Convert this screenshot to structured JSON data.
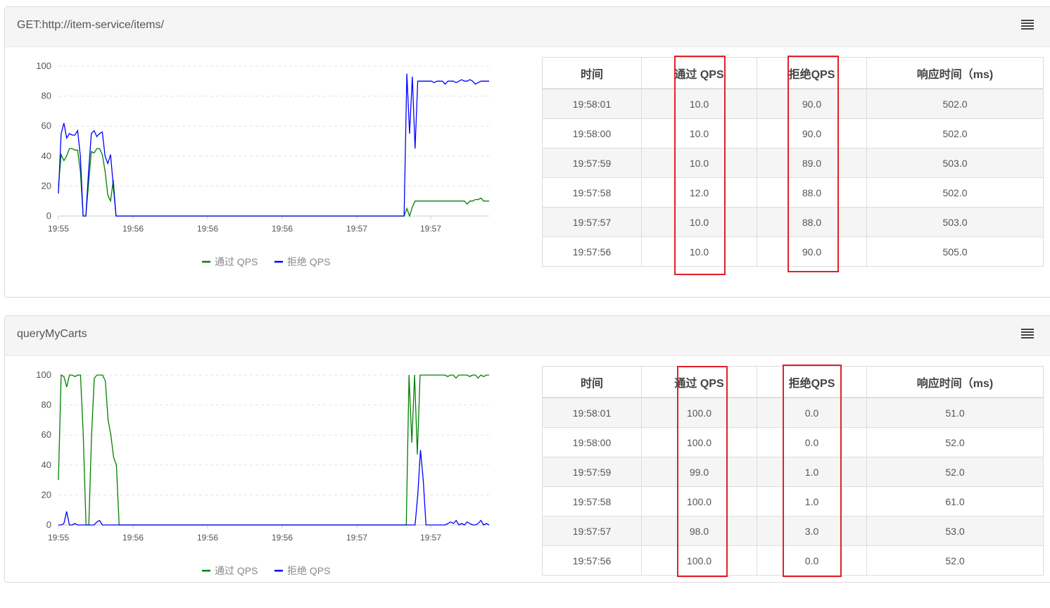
{
  "colors": {
    "pass": "#008000",
    "block": "#0000ff",
    "highlight": "#e0202a"
  },
  "panels": [
    {
      "title": "GET:http://item-service/items/",
      "menu_icon": "hamburger-menu-icon",
      "legend": {
        "pass": "通过 QPS",
        "block": "拒绝 QPS"
      },
      "chart_data": {
        "type": "line",
        "ylim": [
          0,
          100
        ],
        "yticks": [
          0,
          20,
          40,
          60,
          80,
          100
        ],
        "xticks": [
          "19:55",
          "19:56",
          "19:56",
          "19:56",
          "19:57",
          "19:57"
        ],
        "series": [
          {
            "name": "通过 QPS",
            "color": "#008000",
            "values": [
              20,
              41,
              37,
              40,
              45,
              45,
              44,
              44,
              30,
              0,
              0,
              22,
              43,
              42,
              45,
              45,
              41,
              30,
              14,
              10,
              24,
              0,
              0,
              0,
              0,
              0,
              0,
              0,
              0,
              0,
              0,
              0,
              0,
              0,
              0,
              0,
              0,
              0,
              0,
              0,
              0,
              0,
              0,
              0,
              0,
              0,
              0,
              0,
              0,
              0,
              0,
              0,
              0,
              0,
              0,
              0,
              0,
              0,
              0,
              0,
              0,
              0,
              0,
              0,
              0,
              0,
              0,
              0,
              0,
              0,
              0,
              0,
              0,
              0,
              0,
              0,
              0,
              0,
              0,
              0,
              0,
              0,
              0,
              0,
              0,
              0,
              0,
              0,
              0,
              0,
              0,
              0,
              0,
              0,
              0,
              0,
              0,
              0,
              0,
              0,
              0,
              0,
              0,
              0,
              0,
              0,
              0,
              0,
              0,
              0,
              0,
              0,
              0,
              0,
              0,
              0,
              0,
              0,
              0,
              0,
              0,
              0,
              0,
              0,
              0,
              0,
              0,
              5,
              0,
              6,
              10,
              10,
              10,
              10,
              10,
              10,
              10,
              10,
              10,
              10,
              10,
              10,
              10,
              10,
              10,
              10,
              10,
              10,
              10,
              8,
              10,
              10,
              11,
              11,
              12,
              10,
              10,
              10
            ]
          },
          {
            "name": "拒绝 QPS",
            "color": "#0000ff",
            "values": [
              15,
              55,
              62,
              52,
              55,
              54,
              54,
              57,
              40,
              0,
              0,
              30,
              55,
              57,
              53,
              55,
              56,
              40,
              35,
              41,
              20,
              0,
              0,
              0,
              0,
              0,
              0,
              0,
              0,
              0,
              0,
              0,
              0,
              0,
              0,
              0,
              0,
              0,
              0,
              0,
              0,
              0,
              0,
              0,
              0,
              0,
              0,
              0,
              0,
              0,
              0,
              0,
              0,
              0,
              0,
              0,
              0,
              0,
              0,
              0,
              0,
              0,
              0,
              0,
              0,
              0,
              0,
              0,
              0,
              0,
              0,
              0,
              0,
              0,
              0,
              0,
              0,
              0,
              0,
              0,
              0,
              0,
              0,
              0,
              0,
              0,
              0,
              0,
              0,
              0,
              0,
              0,
              0,
              0,
              0,
              0,
              0,
              0,
              0,
              0,
              0,
              0,
              0,
              0,
              0,
              0,
              0,
              0,
              0,
              0,
              0,
              0,
              0,
              0,
              0,
              0,
              0,
              0,
              0,
              0,
              0,
              0,
              0,
              0,
              0,
              0,
              0,
              95,
              55,
              93,
              45,
              90,
              90,
              90,
              90,
              90,
              90,
              89,
              90,
              90,
              90,
              88,
              90,
              90,
              90,
              89,
              90,
              91,
              90,
              90,
              91,
              90,
              88,
              89,
              90,
              90,
              90,
              90
            ]
          }
        ]
      },
      "table": {
        "headers": [
          "时间",
          "通过 QPS",
          "拒绝QPS",
          "响应时间（ms)"
        ],
        "rows": [
          [
            "19:58:01",
            "10.0",
            "90.0",
            "502.0"
          ],
          [
            "19:58:00",
            "10.0",
            "90.0",
            "502.0"
          ],
          [
            "19:57:59",
            "10.0",
            "89.0",
            "503.0"
          ],
          [
            "19:57:58",
            "12.0",
            "88.0",
            "502.0"
          ],
          [
            "19:57:57",
            "10.0",
            "88.0",
            "503.0"
          ],
          [
            "19:57:56",
            "10.0",
            "90.0",
            "505.0"
          ]
        ]
      }
    },
    {
      "title": "queryMyCarts",
      "menu_icon": "hamburger-menu-icon",
      "legend": {
        "pass": "通过 QPS",
        "block": "拒绝 QPS"
      },
      "chart_data": {
        "type": "line",
        "ylim": [
          0,
          100
        ],
        "yticks": [
          0,
          20,
          40,
          60,
          80,
          100
        ],
        "xticks": [
          "19:55",
          "19:56",
          "19:56",
          "19:56",
          "19:57",
          "19:57"
        ],
        "series": [
          {
            "name": "通过 QPS",
            "color": "#008000",
            "values": [
              30,
              100,
              99,
              92,
              100,
              100,
              99,
              100,
              100,
              60,
              0,
              0,
              60,
              98,
              100,
              100,
              100,
              96,
              70,
              60,
              45,
              40,
              0,
              0,
              0,
              0,
              0,
              0,
              0,
              0,
              0,
              0,
              0,
              0,
              0,
              0,
              0,
              0,
              0,
              0,
              0,
              0,
              0,
              0,
              0,
              0,
              0,
              0,
              0,
              0,
              0,
              0,
              0,
              0,
              0,
              0,
              0,
              0,
              0,
              0,
              0,
              0,
              0,
              0,
              0,
              0,
              0,
              0,
              0,
              0,
              0,
              0,
              0,
              0,
              0,
              0,
              0,
              0,
              0,
              0,
              0,
              0,
              0,
              0,
              0,
              0,
              0,
              0,
              0,
              0,
              0,
              0,
              0,
              0,
              0,
              0,
              0,
              0,
              0,
              0,
              0,
              0,
              0,
              0,
              0,
              0,
              0,
              0,
              0,
              0,
              0,
              0,
              0,
              0,
              0,
              0,
              0,
              0,
              0,
              0,
              0,
              0,
              0,
              0,
              0,
              0,
              0,
              100,
              55,
              100,
              47,
              100,
              100,
              100,
              100,
              100,
              100,
              100,
              100,
              100,
              100,
              99,
              100,
              100,
              98,
              100,
              100,
              100,
              100,
              99,
              100,
              100,
              98,
              100,
              99,
              100,
              100
            ]
          },
          {
            "name": "拒绝 QPS",
            "color": "#0000ff",
            "values": [
              0,
              0,
              1,
              9,
              0,
              0,
              1,
              0,
              0,
              0,
              0,
              0,
              0,
              0,
              2,
              3,
              0,
              0,
              0,
              0,
              0,
              0,
              0,
              0,
              0,
              0,
              0,
              0,
              0,
              0,
              0,
              0,
              0,
              0,
              0,
              0,
              0,
              0,
              0,
              0,
              0,
              0,
              0,
              0,
              0,
              0,
              0,
              0,
              0,
              0,
              0,
              0,
              0,
              0,
              0,
              0,
              0,
              0,
              0,
              0,
              0,
              0,
              0,
              0,
              0,
              0,
              0,
              0,
              0,
              0,
              0,
              0,
              0,
              0,
              0,
              0,
              0,
              0,
              0,
              0,
              0,
              0,
              0,
              0,
              0,
              0,
              0,
              0,
              0,
              0,
              0,
              0,
              0,
              0,
              0,
              0,
              0,
              0,
              0,
              0,
              0,
              0,
              0,
              0,
              0,
              0,
              0,
              0,
              0,
              0,
              0,
              0,
              0,
              0,
              0,
              0,
              0,
              0,
              0,
              0,
              0,
              0,
              0,
              0,
              0,
              0,
              0,
              0,
              0,
              0,
              0,
              20,
              50,
              30,
              0,
              0,
              0,
              0,
              0,
              0,
              0,
              0,
              1,
              2,
              1,
              3,
              0,
              1,
              0,
              2,
              1,
              0,
              0,
              1,
              3,
              0,
              1,
              0
            ]
          }
        ]
      },
      "table": {
        "headers": [
          "时间",
          "通过 QPS",
          "拒绝QPS",
          "响应时间（ms)"
        ],
        "rows": [
          [
            "19:58:01",
            "100.0",
            "0.0",
            "51.0"
          ],
          [
            "19:58:00",
            "100.0",
            "0.0",
            "52.0"
          ],
          [
            "19:57:59",
            "99.0",
            "1.0",
            "52.0"
          ],
          [
            "19:57:58",
            "100.0",
            "1.0",
            "61.0"
          ],
          [
            "19:57:57",
            "98.0",
            "3.0",
            "53.0"
          ],
          [
            "19:57:56",
            "100.0",
            "0.0",
            "52.0"
          ]
        ]
      }
    }
  ]
}
